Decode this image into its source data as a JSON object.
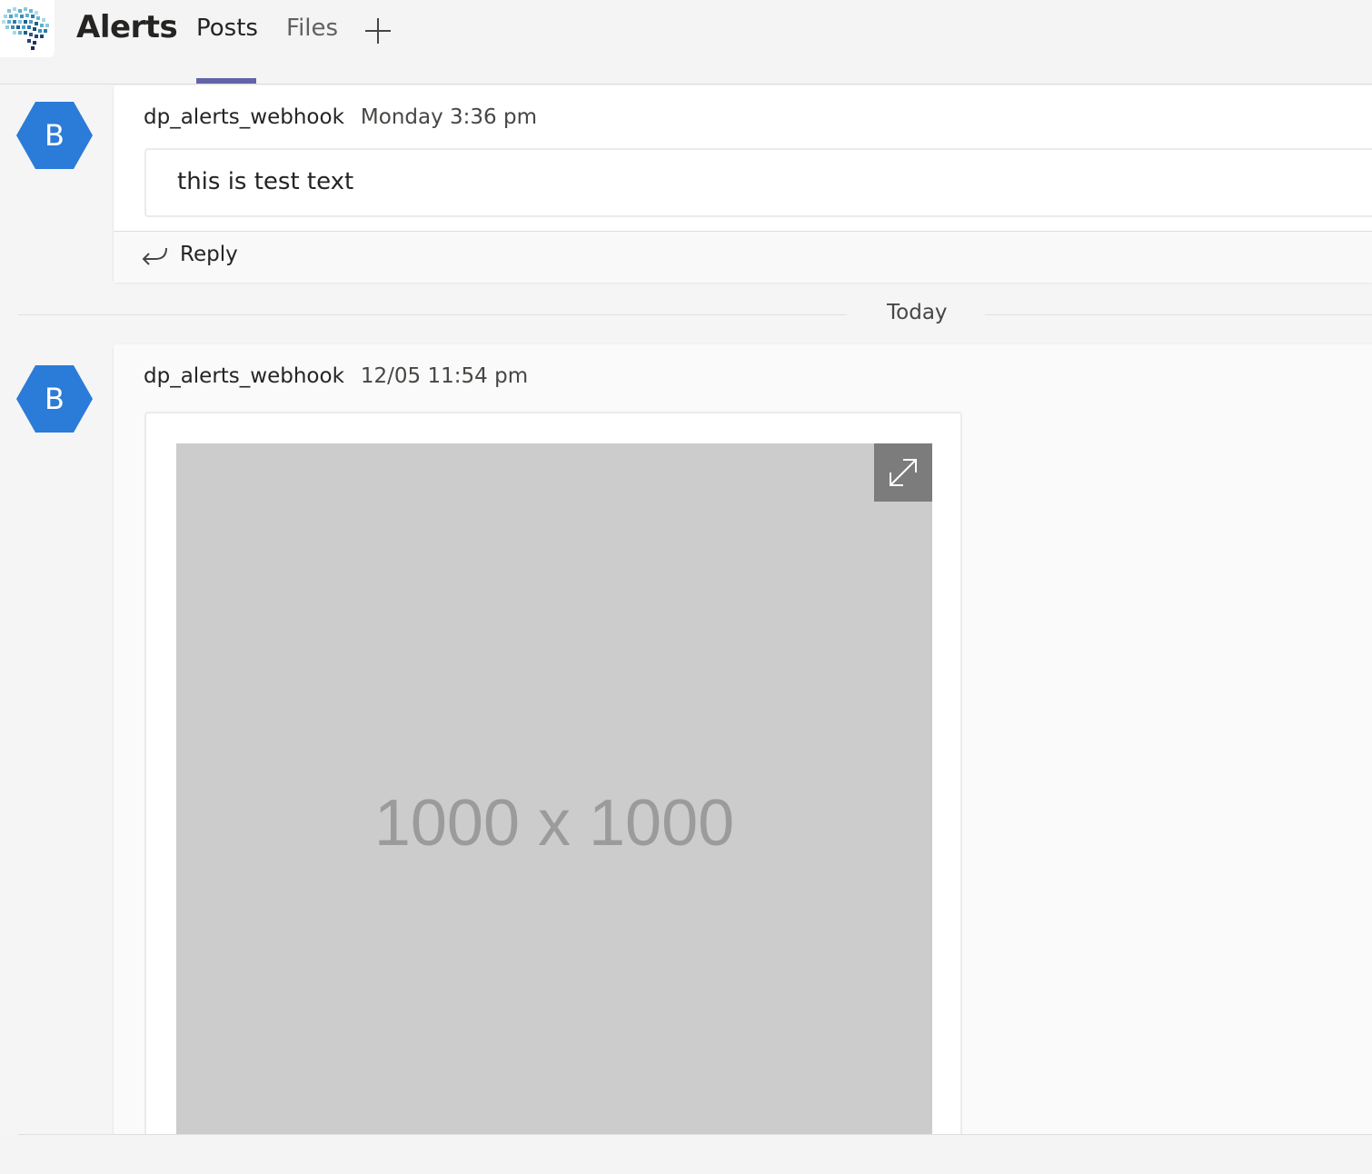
{
  "header": {
    "team_logo_icon": "brain-logo-icon",
    "channel_title": "Alerts",
    "tabs": [
      {
        "label": "Posts",
        "active": true
      },
      {
        "label": "Files",
        "active": false
      }
    ],
    "add_tab_icon": "plus-icon",
    "accent_color": "#6264a7"
  },
  "posts": [
    {
      "avatar_letter": "B",
      "avatar_color": "#2b7bd8",
      "author": "dp_alerts_webhook",
      "timestamp": "Monday 3:36 pm",
      "message": "this is test text",
      "reply_label": "Reply",
      "reply_icon": "reply-arrow-icon"
    },
    {
      "avatar_letter": "B",
      "avatar_color": "#2b7bd8",
      "author": "dp_alerts_webhook",
      "timestamp": "12/05 11:54 pm",
      "image": {
        "placeholder_text": "1000 x 1000",
        "expand_icon": "expand-icon"
      }
    }
  ],
  "divider": {
    "label": "Today"
  }
}
